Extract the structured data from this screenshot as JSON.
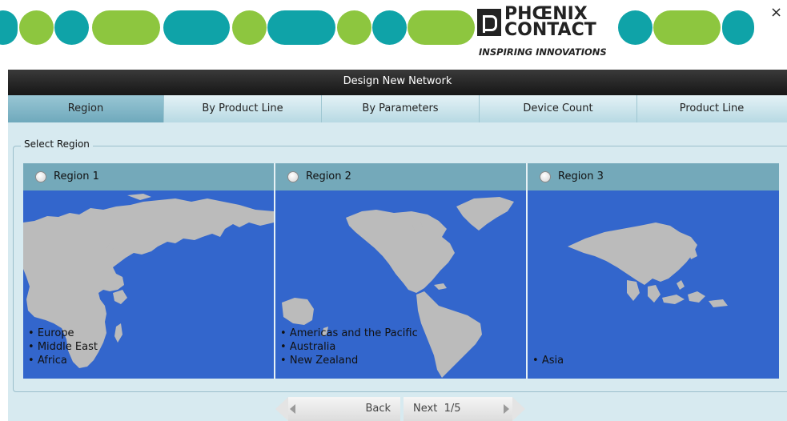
{
  "brand": {
    "line1": "PHŒNIX",
    "line2": "CONTACT",
    "tagline": "INSPIRING INNOVATIONS",
    "colors": {
      "green": "#8dc63f",
      "teal": "#0fa3a8"
    }
  },
  "window": {
    "close_icon": "×",
    "title": "Design New Network"
  },
  "tabs": [
    {
      "label": "Region",
      "active": true
    },
    {
      "label": "By Product Line",
      "active": false
    },
    {
      "label": "By Parameters",
      "active": false
    },
    {
      "label": "Device Count",
      "active": false
    },
    {
      "label": "Product Line",
      "active": false
    }
  ],
  "section": {
    "legend": "Select Region"
  },
  "regions": [
    {
      "label": "Region 1",
      "selected": false,
      "areas": [
        "Europe",
        "Middle East",
        "Africa"
      ]
    },
    {
      "label": "Region 2",
      "selected": false,
      "areas": [
        "Americas and the Pacific",
        "Australia",
        "New Zealand"
      ]
    },
    {
      "label": "Region 3",
      "selected": false,
      "areas": [
        "Asia"
      ]
    }
  ],
  "map_colors": {
    "ocean": "#3366cc",
    "land": "#bbbbbb"
  },
  "nav": {
    "back_label": "Back",
    "next_label": "Next",
    "page": "1/5"
  }
}
